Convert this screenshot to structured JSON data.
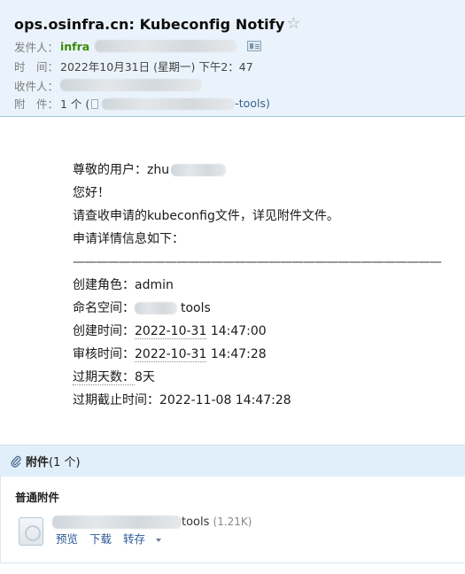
{
  "header": {
    "subject": "ops.osinfra.cn: Kubeconfig Notify",
    "sender_label": "发件人：",
    "sender_name": "infra",
    "time_label": "时　间：",
    "time_value": "2022年10月31日 (星期一) 下午2：47",
    "recipient_label": "收件人：",
    "attachment_label": "附　件：",
    "attachment_count": "1 个 (",
    "attachment_tail": "-tools)"
  },
  "body": {
    "greeting_prefix": "尊敬的用户：zhu",
    "hello": "您好！",
    "check_line": "请查收申请的kubeconfig文件，详见附件文件。",
    "details_intro": "申请详情信息如下：",
    "separator": "————————————————————————————————",
    "role_label": "创建角色：",
    "role_value": "admin",
    "namespace_label": "命名空间：",
    "namespace_value": "tools",
    "created_label": "创建时间：",
    "created_date": "2022-10-31",
    "created_time": " 14:47:00",
    "reviewed_label": "审核时间：",
    "reviewed_date": "2022-10-31",
    "reviewed_time": " 14:47:28",
    "expiry_days_label": "过期天数：",
    "expiry_days_value": "8天",
    "deadline_label": "过期截止时间：",
    "deadline_value": "2022-11-08 14:47:28"
  },
  "attachments": {
    "title": "附件",
    "count": "(1 个)",
    "section_title": "普通附件",
    "file_name_tail": "tools",
    "file_size": "(1.21K)",
    "actions": {
      "preview": "预览",
      "download": "下载",
      "save_to": "转存"
    }
  },
  "colors": {
    "header_bg": "#eaf3fb",
    "sender_green": "#3a8a08",
    "link_blue": "#2c5896",
    "attach_bar_bg": "#e1effa"
  },
  "icons": [
    "star-icon",
    "contact-card-icon",
    "file-doc-icon",
    "paperclip-icon",
    "file-icon",
    "caret-down-icon"
  ]
}
